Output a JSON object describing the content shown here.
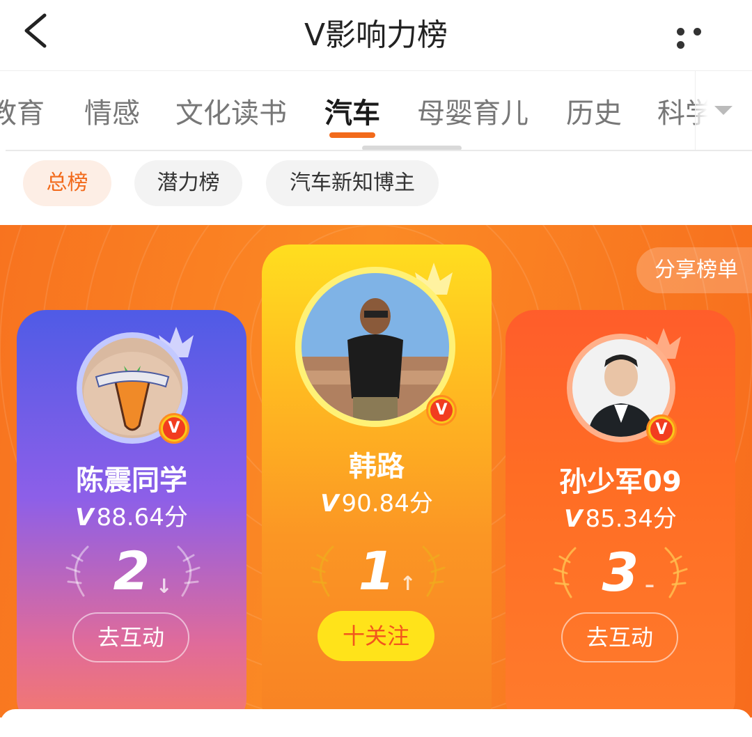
{
  "header": {
    "title": "V影响力榜",
    "back_icon": "chevron-left-icon",
    "more_icon": "more-dots-icon"
  },
  "tabs": {
    "items": [
      {
        "label": "教育"
      },
      {
        "label": "情感"
      },
      {
        "label": "文化读书"
      },
      {
        "label": "汽车"
      },
      {
        "label": "母婴育儿"
      },
      {
        "label": "历史"
      },
      {
        "label": "科学"
      }
    ],
    "active": "汽车",
    "dropdown_icon": "triangle-down-icon"
  },
  "filters": {
    "items": [
      {
        "label": "总榜"
      },
      {
        "label": "潜力榜"
      },
      {
        "label": "汽车新知博主"
      }
    ],
    "active": "总榜"
  },
  "banner": {
    "share_label": "分享榜单",
    "accent": "#f8731f"
  },
  "podium": [
    {
      "rank": "2",
      "name": "陈震同学",
      "score_prefix": "V",
      "score": "88.64分",
      "trend": "↓",
      "action": "去互动"
    },
    {
      "rank": "1",
      "name": "韩路",
      "score_prefix": "V",
      "score": "90.84分",
      "trend": "↑",
      "action": "十关注"
    },
    {
      "rank": "3",
      "name": "孙少军09",
      "score_prefix": "V",
      "score": "85.34分",
      "trend": "–",
      "action": "去互动"
    }
  ],
  "badge": {
    "letter": "V"
  }
}
